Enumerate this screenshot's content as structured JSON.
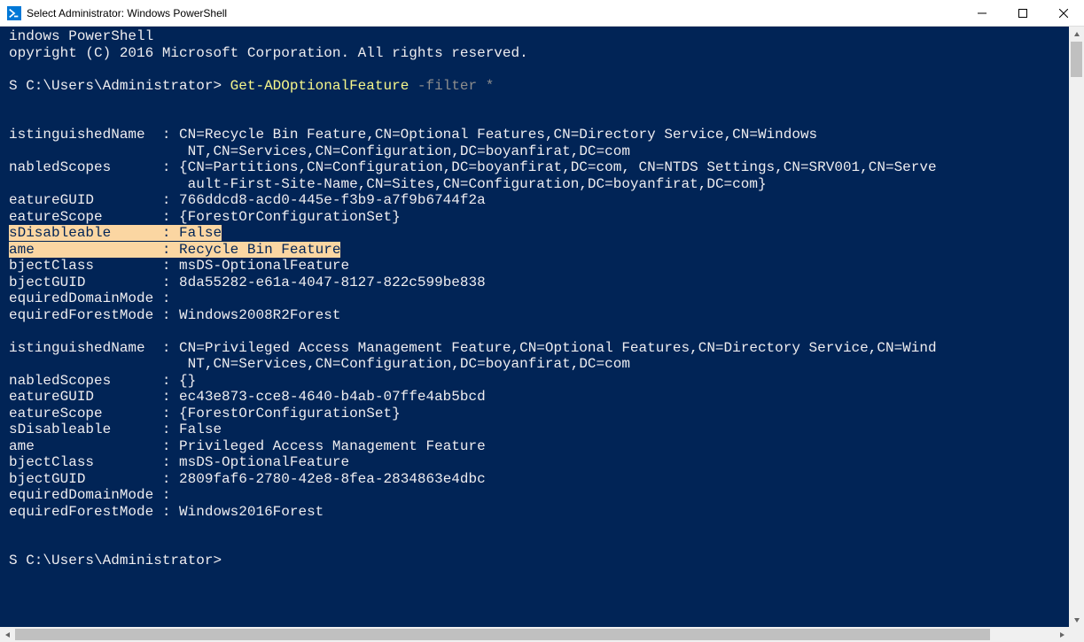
{
  "window": {
    "title": "Select Administrator: Windows PowerShell"
  },
  "terminal": {
    "header_line1": "indows PowerShell",
    "header_line2": "opyright (C) 2016 Microsoft Corporation. All rights reserved.",
    "prompt": "S C:\\Users\\Administrator>",
    "cmd_name": "Get-ADOptionalFeature",
    "cmd_param_flag": "-filter",
    "cmd_param_value": "*",
    "labels": {
      "distinguishedName": "istinguishedName",
      "enabledScopes": "nabledScopes",
      "featureGUID": "eatureGUID",
      "featureScope": "eatureScope",
      "isDisableable": "sDisableable",
      "name": "ame",
      "objectClass": "bjectClass",
      "objectGUID": "bjectGUID",
      "requiredDomainMode": "equiredDomainMode",
      "requiredForestMode": "equiredForestMode"
    },
    "block1": {
      "distinguishedName_l1": "CN=Recycle Bin Feature,CN=Optional Features,CN=Directory Service,CN=Windows",
      "distinguishedName_l2": "NT,CN=Services,CN=Configuration,DC=boyanfirat,DC=com",
      "enabledScopes_l1": "{CN=Partitions,CN=Configuration,DC=boyanfirat,DC=com, CN=NTDS Settings,CN=SRV001,CN=Serve",
      "enabledScopes_l2": "ault-First-Site-Name,CN=Sites,CN=Configuration,DC=boyanfirat,DC=com}",
      "featureGUID": "766ddcd8-acd0-445e-f3b9-a7f9b6744f2a",
      "featureScope": "{ForestOrConfigurationSet}",
      "isDisableable": "False",
      "name": "Recycle Bin Feature",
      "objectClass": "msDS-OptionalFeature",
      "objectGUID": "8da55282-e61a-4047-8127-822c599be838",
      "requiredDomainMode": "",
      "requiredForestMode": "Windows2008R2Forest"
    },
    "block2": {
      "distinguishedName_l1": "CN=Privileged Access Management Feature,CN=Optional Features,CN=Directory Service,CN=Wind",
      "distinguishedName_l2": "NT,CN=Services,CN=Configuration,DC=boyanfirat,DC=com",
      "enabledScopes": "{}",
      "featureGUID": "ec43e873-cce8-4640-b4ab-07ffe4ab5bcd",
      "featureScope": "{ForestOrConfigurationSet}",
      "isDisableable": "False",
      "name": "Privileged Access Management Feature",
      "objectClass": "msDS-OptionalFeature",
      "objectGUID": "2809faf6-2780-42e8-8fea-2834863e4dbc",
      "requiredDomainMode": "",
      "requiredForestMode": "Windows2016Forest"
    }
  }
}
